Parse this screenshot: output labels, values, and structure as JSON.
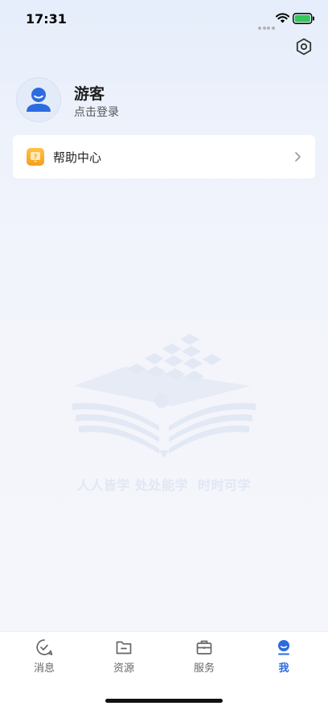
{
  "status_bar": {
    "time": "17:31",
    "wifi_icon": "wifi-icon",
    "battery_icon": "battery-icon",
    "battery_color": "#34c759"
  },
  "header": {
    "settings_icon": "settings-hex-icon"
  },
  "profile": {
    "name": "游客",
    "login_hint": "点击登录",
    "avatar_color": "#2c6be0"
  },
  "menu": {
    "items": [
      {
        "label": "帮助中心",
        "icon": "help-center-icon",
        "icon_color": "#f5a623"
      }
    ]
  },
  "watermark": {
    "slogan": "人人皆学 处处能学  时时可学"
  },
  "tab_bar": {
    "accent_color": "#2c6be0",
    "tabs": [
      {
        "label": "消息",
        "icon": "message-icon",
        "active": false
      },
      {
        "label": "资源",
        "icon": "folder-icon",
        "active": false
      },
      {
        "label": "服务",
        "icon": "briefcase-icon",
        "active": false
      },
      {
        "label": "我",
        "icon": "user-icon",
        "active": true
      }
    ]
  }
}
